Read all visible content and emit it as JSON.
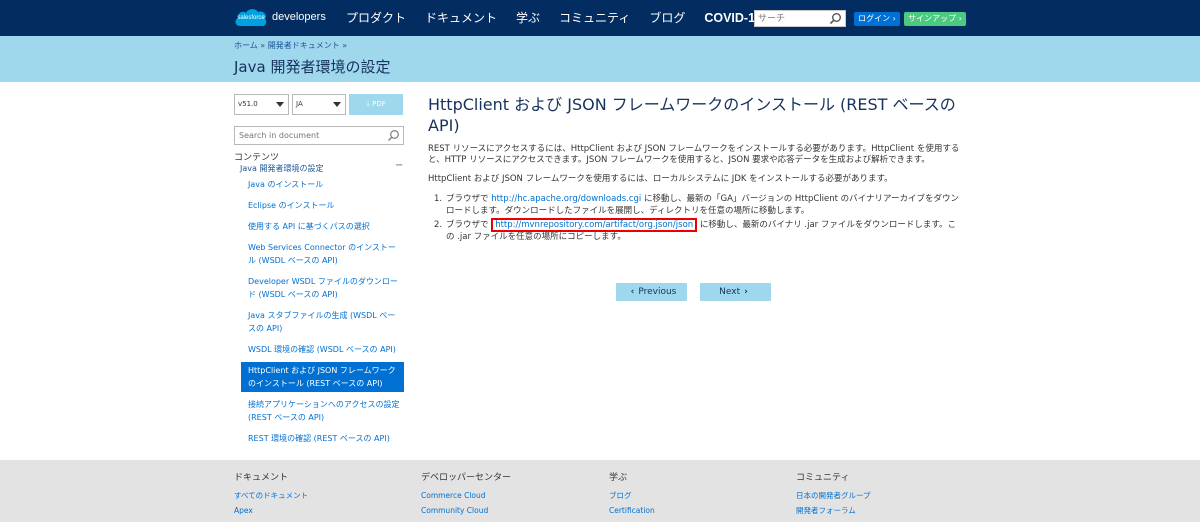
{
  "header": {
    "logo_cloud": "salesforce",
    "logo_text": "developers",
    "nav": [
      "プロダクト",
      "ドキュメント",
      "学ぶ",
      "コミュニティ",
      "ブログ",
      "COVID-19"
    ],
    "search_placeholder": "サーチ",
    "login_label": "ログイン ›",
    "signup_label": "サインアップ ›"
  },
  "band": {
    "breadcrumb": "ホーム » 開発者ドキュメント »",
    "title": "Java 開発者環境の設定"
  },
  "sidebar": {
    "version": "v51.0",
    "language": "JA",
    "pdf_label": "🡓 PDF",
    "search_placeholder": "Search in document",
    "toc_heading": "コンテンツ",
    "toc_root": "Java 開発者環境の設定",
    "toc_collapse": "−",
    "items": [
      {
        "label": "Java のインストール",
        "active": false
      },
      {
        "label": "Eclipse のインストール",
        "active": false
      },
      {
        "label": "使用する API に基づくパスの選択",
        "active": false
      },
      {
        "label": "Web Services Connector のインストール (WSDL ベースの API)",
        "active": false
      },
      {
        "label": "Developer WSDL ファイルのダウンロード (WSDL ベースの API)",
        "active": false
      },
      {
        "label": "Java スタブファイルの生成 (WSDL ベースの API)",
        "active": false
      },
      {
        "label": "WSDL 環境の確認 (WSDL ベースの API)",
        "active": false
      },
      {
        "label": "HttpClient および JSON フレームワークのインストール (REST ベースの API)",
        "active": true
      },
      {
        "label": "接続アプリケーションへのアクセスの設定 (REST ベースの API)",
        "active": false
      },
      {
        "label": "REST 環境の確認 (REST ベースの API)",
        "active": false
      }
    ]
  },
  "main": {
    "heading": "HttpClient および JSON フレームワークのインストール (REST ベースの API)",
    "para1": "REST リソースにアクセスするには、HttpClient および JSON フレームワークをインストールする必要があります。HttpClient を使用すると、HTTP リソースにアクセスできます。JSON フレームワークを使用すると、JSON 要求や応答データを生成および解析できます。",
    "para2": "HttpClient および JSON フレームワークを使用するには、ローカルシステムに JDK をインストールする必要があります。",
    "steps": [
      {
        "num": "1.",
        "before": "ブラウザで ",
        "link": "http://hc.apache.org/downloads.cgi",
        "after": " に移動し、最新の「GA」バージョンの HttpClient のバイナリアーカイブをダウンロードします。ダウンロードしたファイルを展開し、ディレクトリを任意の場所に移動します。"
      },
      {
        "num": "2.",
        "before": "ブラウザで ",
        "link": "http://mvnrepository.com/artifact/org.json/json",
        "after": " に移動し、最新のバイナリ .jar ファイルをダウンロードします。この .jar ファイルを任意の場所にコピーします。"
      }
    ],
    "prev_label": "Previous",
    "next_label": "Next"
  },
  "footer": {
    "columns": [
      {
        "heading": "ドキュメント",
        "links": [
          "すべてのドキュメント",
          "Apex"
        ]
      },
      {
        "heading": "デベロッパーセンター",
        "links": [
          "Commerce Cloud",
          "Community Cloud"
        ]
      },
      {
        "heading": "学ぶ",
        "links": [
          "ブログ",
          "Certification"
        ]
      },
      {
        "heading": "コミュニティ",
        "links": [
          "日本の開発者グループ",
          "開発者フォーラム"
        ]
      }
    ]
  },
  "colors": {
    "nav_bg": "#032d60",
    "band_bg": "#9fd7ed",
    "link": "#0070d2",
    "login": "#0070d2",
    "signup": "#4bca81",
    "highlight_box": "#e00000"
  }
}
